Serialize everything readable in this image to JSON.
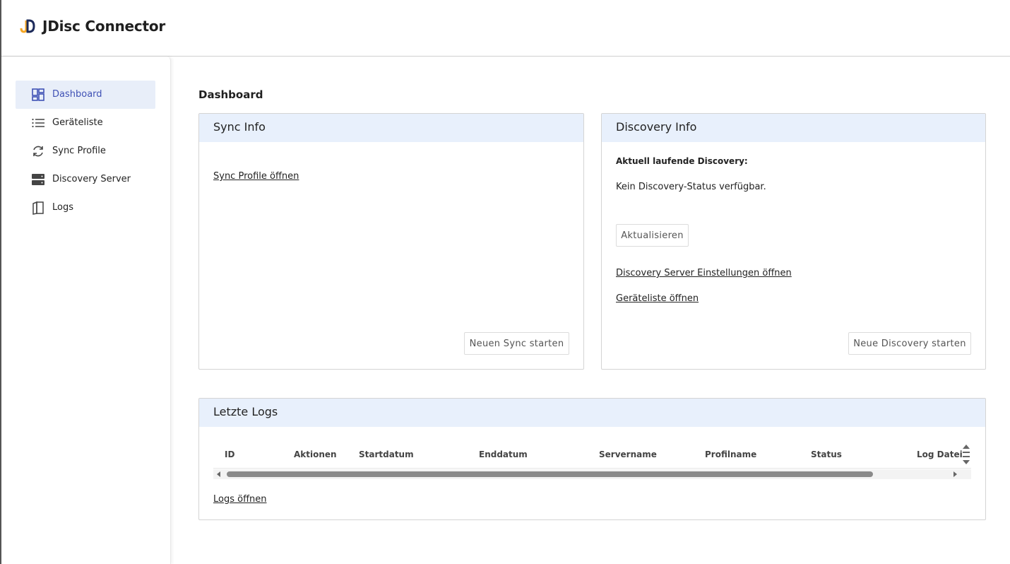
{
  "app": {
    "title": "JDisc Connector",
    "logo_icon": "jdisc-logo-icon"
  },
  "colors": {
    "accent": "#3f51b5",
    "active_bg": "#e8eef9",
    "card_head_bg": "#e8f0fc",
    "logo_orange": "#f5a623",
    "logo_navy": "#1c2a5a"
  },
  "sidebar": {
    "items": [
      {
        "label": "Dashboard",
        "icon": "dashboard-icon",
        "active": true
      },
      {
        "label": "Geräteliste",
        "icon": "list-icon",
        "active": false
      },
      {
        "label": "Sync Profile",
        "icon": "sync-icon",
        "active": false
      },
      {
        "label": "Discovery Server",
        "icon": "server-icon",
        "active": false
      },
      {
        "label": "Logs",
        "icon": "logs-icon",
        "active": false
      }
    ]
  },
  "main": {
    "title": "Dashboard",
    "sync_card": {
      "title": "Sync Info",
      "link": "Sync Profile öffnen",
      "button": "Neuen Sync starten"
    },
    "discovery_card": {
      "title": "Discovery Info",
      "current_label": "Aktuell laufende Discovery:",
      "status_text": "Kein Discovery-Status verfügbar.",
      "refresh_button": "Aktualisieren",
      "settings_link": "Discovery Server Einstellungen öffnen",
      "devices_link": "Geräteliste öffnen",
      "start_button": "Neue Discovery starten"
    },
    "logs_card": {
      "title": "Letzte Logs",
      "columns": [
        "ID",
        "Aktionen",
        "Startdatum",
        "Enddatum",
        "Servername",
        "Profilname",
        "Status",
        "Log Datei"
      ],
      "link": "Logs öffnen"
    }
  }
}
